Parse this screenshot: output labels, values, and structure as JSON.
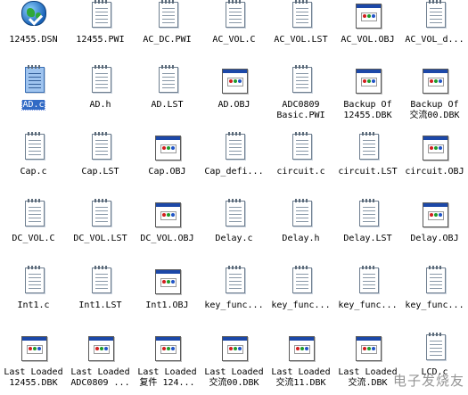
{
  "files": [
    {
      "name": "12455.DSN",
      "icon": "dsn-file-icon"
    },
    {
      "name": "12455.PWI",
      "icon": "notepad-file-icon"
    },
    {
      "name": "AC_DC.PWI",
      "icon": "notepad-file-icon"
    },
    {
      "name": "AC_VOL.C",
      "icon": "notepad-file-icon"
    },
    {
      "name": "AC_VOL.LST",
      "icon": "notepad-file-icon"
    },
    {
      "name": "AC_VOL.OBJ",
      "icon": "obj-file-icon"
    },
    {
      "name": "AC_VOL_d...",
      "icon": "notepad-file-icon"
    },
    {
      "name": "AD.c",
      "icon": "notepad-file-icon",
      "selected": true
    },
    {
      "name": "AD.h",
      "icon": "notepad-file-icon"
    },
    {
      "name": "AD.LST",
      "icon": "notepad-file-icon"
    },
    {
      "name": "AD.OBJ",
      "icon": "obj-file-icon"
    },
    {
      "name": "ADC0809\nBasic.PWI",
      "icon": "notepad-file-icon"
    },
    {
      "name": "Backup Of\n12455.DBK",
      "icon": "obj-file-icon"
    },
    {
      "name": "Backup Of\n交流00.DBK",
      "icon": "obj-file-icon"
    },
    {
      "name": "Cap.c",
      "icon": "notepad-file-icon"
    },
    {
      "name": "Cap.LST",
      "icon": "notepad-file-icon"
    },
    {
      "name": "Cap.OBJ",
      "icon": "obj-file-icon"
    },
    {
      "name": "Cap_defi...",
      "icon": "notepad-file-icon"
    },
    {
      "name": "circuit.c",
      "icon": "notepad-file-icon"
    },
    {
      "name": "circuit.LST",
      "icon": "notepad-file-icon"
    },
    {
      "name": "circuit.OBJ",
      "icon": "obj-file-icon"
    },
    {
      "name": "DC_VOL.C",
      "icon": "notepad-file-icon"
    },
    {
      "name": "DC_VOL.LST",
      "icon": "notepad-file-icon"
    },
    {
      "name": "DC_VOL.OBJ",
      "icon": "obj-file-icon"
    },
    {
      "name": "Delay.c",
      "icon": "notepad-file-icon"
    },
    {
      "name": "Delay.h",
      "icon": "notepad-file-icon"
    },
    {
      "name": "Delay.LST",
      "icon": "notepad-file-icon"
    },
    {
      "name": "Delay.OBJ",
      "icon": "obj-file-icon"
    },
    {
      "name": "Int1.c",
      "icon": "notepad-file-icon"
    },
    {
      "name": "Int1.LST",
      "icon": "notepad-file-icon"
    },
    {
      "name": "Int1.OBJ",
      "icon": "obj-file-icon"
    },
    {
      "name": "key_func...",
      "icon": "notepad-file-icon"
    },
    {
      "name": "key_func...",
      "icon": "notepad-file-icon"
    },
    {
      "name": "key_func...",
      "icon": "notepad-file-icon"
    },
    {
      "name": "key_func...",
      "icon": "notepad-file-icon"
    },
    {
      "name": "Last Loaded\n12455.DBK",
      "icon": "obj-file-icon"
    },
    {
      "name": "Last Loaded\nADC0809 ...",
      "icon": "obj-file-icon"
    },
    {
      "name": "Last Loaded\n复件 124...",
      "icon": "obj-file-icon"
    },
    {
      "name": "Last Loaded\n交流00.DBK",
      "icon": "obj-file-icon"
    },
    {
      "name": "Last Loaded\n交流11.DBK",
      "icon": "obj-file-icon"
    },
    {
      "name": "Last Loaded\n交流.DBK",
      "icon": "obj-file-icon"
    },
    {
      "name": "LCD.c",
      "icon": "notepad-file-icon"
    }
  ],
  "watermark": "电子发烧友"
}
